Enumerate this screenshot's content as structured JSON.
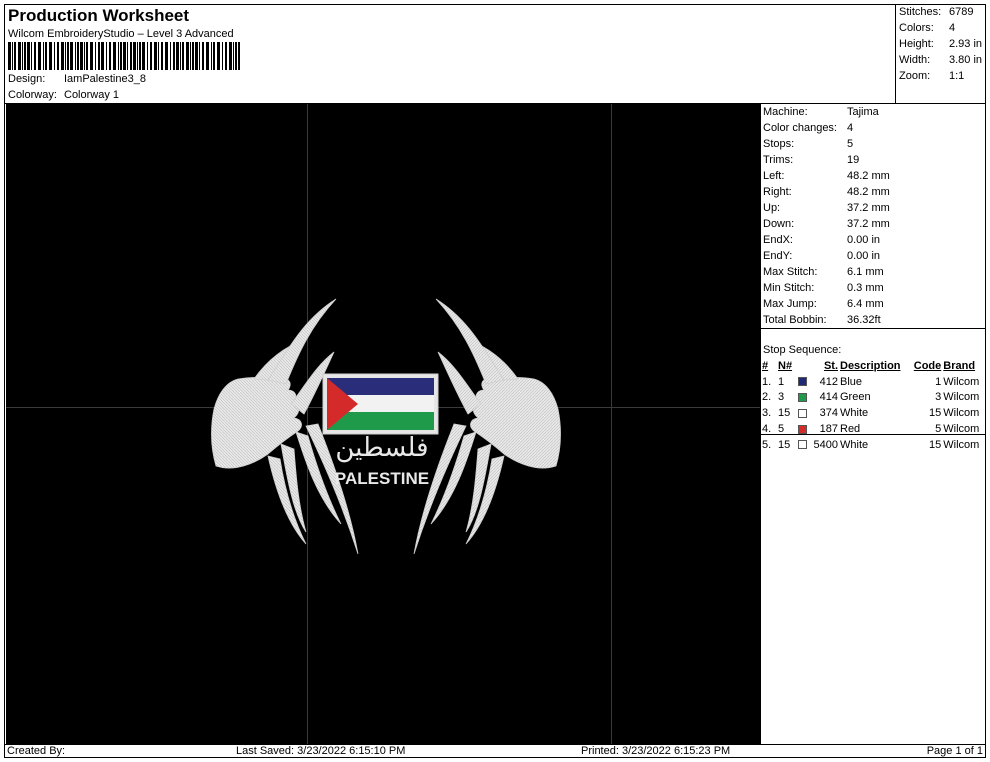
{
  "header": {
    "title": "Production Worksheet",
    "software": "Wilcom EmbroideryStudio – Level 3 Advanced",
    "design_label": "Design:",
    "design_value": "IamPalestine3_8",
    "colorway_label": "Colorway:",
    "colorway_value": "Colorway 1"
  },
  "summary": [
    {
      "label": "Stitches:",
      "value": "6789"
    },
    {
      "label": "Colors:",
      "value": "4"
    },
    {
      "label": "Height:",
      "value": "2.93 in"
    },
    {
      "label": "Width:",
      "value": "3.80 in"
    },
    {
      "label": "Zoom:",
      "value": "1:1"
    }
  ],
  "machine_info": [
    {
      "label": "Machine:",
      "value": "Tajima"
    },
    {
      "label": "Color changes:",
      "value": "4"
    },
    {
      "label": "Stops:",
      "value": "5"
    },
    {
      "label": "Trims:",
      "value": "19"
    },
    {
      "label": "Left:",
      "value": "48.2 mm"
    },
    {
      "label": "Right:",
      "value": "48.2 mm"
    },
    {
      "label": "Up:",
      "value": "37.2 mm"
    },
    {
      "label": "Down:",
      "value": "37.2 mm"
    },
    {
      "label": "EndX:",
      "value": "0.00 in"
    },
    {
      "label": "EndY:",
      "value": "0.00 in"
    },
    {
      "label": "Max Stitch:",
      "value": "6.1 mm"
    },
    {
      "label": "Min Stitch:",
      "value": "0.3 mm"
    },
    {
      "label": "Max Jump:",
      "value": "6.4 mm"
    },
    {
      "label": "Total Bobbin:",
      "value": "36.32ft"
    }
  ],
  "stop_sequence": {
    "title": "Stop Sequence:",
    "columns": [
      "#",
      "N#",
      "",
      "St.",
      "Description",
      "Code",
      "Brand"
    ],
    "rows": [
      {
        "num": "1.",
        "n": "1",
        "color": "#1e2a78",
        "st": "412",
        "desc": "Blue",
        "code": "1",
        "brand": "Wilcom"
      },
      {
        "num": "2.",
        "n": "3",
        "color": "#1f9a4a",
        "st": "414",
        "desc": "Green",
        "code": "3",
        "brand": "Wilcom"
      },
      {
        "num": "3.",
        "n": "15",
        "color": "#ffffff",
        "st": "374",
        "desc": "White",
        "code": "15",
        "brand": "Wilcom"
      },
      {
        "num": "4.",
        "n": "5",
        "color": "#d42a2a",
        "st": "187",
        "desc": "Red",
        "code": "5",
        "brand": "Wilcom"
      },
      {
        "num": "5.",
        "n": "15",
        "color": "#ffffff",
        "st": "5400",
        "desc": "White",
        "code": "15",
        "brand": "Wilcom"
      }
    ]
  },
  "design": {
    "arabic_text": "فلسطين",
    "label_text": "PALESTINE"
  },
  "footer": {
    "created": "Created By:",
    "last_saved": "Last Saved: 3/23/2022 6:15:10 PM",
    "printed": "Printed: 3/23/2022 6:15:23 PM",
    "page": "Page 1 of 1"
  }
}
